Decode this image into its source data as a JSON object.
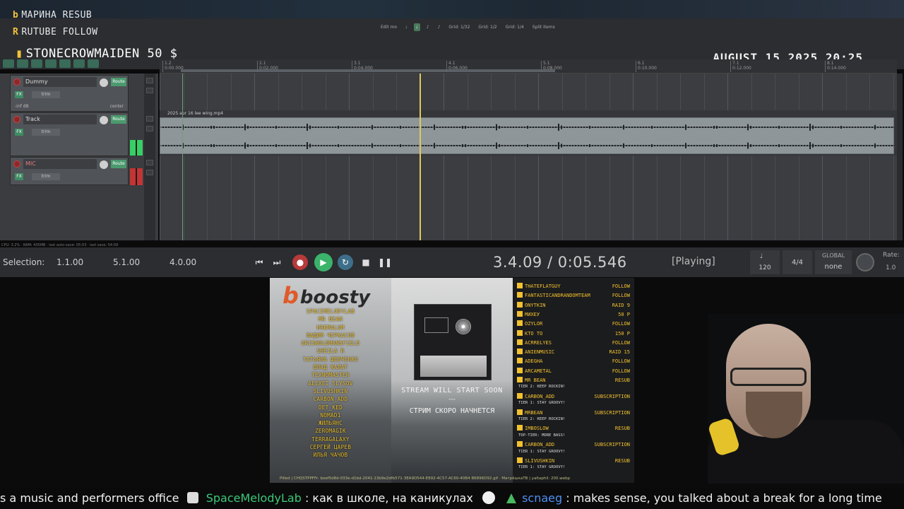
{
  "alerts": {
    "line1": "МАРИНА RESUB",
    "line2": "RUTUBE FOLLOW",
    "line3": "STONECROWMAIDEN 50 $"
  },
  "datetime": "AUGUST 15 2025 20:25",
  "toolbar_mid": {
    "edit_label": "Edit mo",
    "grid1": "Grid: 1/32",
    "grid2": "Grid: 1/2",
    "grid3": "Grid: 1/4",
    "split": "Split items"
  },
  "ruler": {
    "ticks": [
      "1.2",
      "2.1",
      "3.1",
      "4.1",
      "5.1",
      "6.1",
      "7.1",
      "8.1"
    ],
    "times": [
      "0:00.000",
      "0:02.000",
      "0:04.000",
      "0:06.000",
      "0:08.000",
      "0:10.000",
      "0:12.000",
      "0:14.000"
    ]
  },
  "tracks": [
    {
      "name": "Dummy",
      "sub": "-inf dB",
      "pan": "center",
      "route": "Route",
      "trim": "trim"
    },
    {
      "name": "Track",
      "route": "Route",
      "trim": "trim"
    },
    {
      "name": "MIC",
      "route": "Route",
      "trim": "trim"
    }
  ],
  "item_label": "2025 apr 16 lee wing.mp4",
  "tcp_footer": "CPU: 3.2% · RAM: 435MB · last auto-save: 05:03 · last save: 54:09",
  "transport": {
    "selection_label": "Selection:",
    "sel_start": "1.1.00",
    "sel_end": "5.1.00",
    "sel_len": "4.0.00",
    "position": "3.4.09 / 0:05.546",
    "status": "[Playing]",
    "bpm": "120",
    "time_sig": "4/4",
    "global_label": "GLOBAL",
    "global_value": "none",
    "rate_label": "Rate:",
    "rate_value": "1.0"
  },
  "boosty": {
    "brand": "boosty",
    "supporters": [
      "SPACEMELODYLAB",
      "MR BEAN",
      "HREMALUM",
      "ВАДИМ ЧЕРКАСОВ",
      "GRISWOLDMANSFIELD",
      "SHEILA R",
      "ТАТЬЯНА ШЕВЧЕНКО",
      "ВЛАД КАЛАТ",
      "TEXNOMASTER",
      "ALEXEI SLYSOV",
      "SLIVUSHKIN",
      "CARBON_ADD",
      "DET_KED",
      "NOMAD1",
      "ЖИЛЬЯНС",
      "ZEROMAGIK",
      "TERRAGALAXY",
      "СЕРГЕЙ ЦАРЕВ",
      "ИЛЬЯ ЧАЧОВ"
    ]
  },
  "cover": {
    "msg1": "STREAM WILL START SOON",
    "dash": "---",
    "msg2": "СТРИМ СКОРО НАЧНЕТСЯ"
  },
  "events": [
    {
      "user": "THATEFLATGUY",
      "action": "FOLLOW"
    },
    {
      "user": "FANTASTICANDRANDOMTEAM",
      "action": "FOLLOW"
    },
    {
      "user": "ONYTKIN",
      "action": "RAID 9"
    },
    {
      "user": "МИХЕУ",
      "action": "50 Р"
    },
    {
      "user": "OZYLOR",
      "action": "FOLLOW"
    },
    {
      "user": "КТО ТО",
      "action": "150 Р"
    },
    {
      "user": "ACRRELYES",
      "action": "FOLLOW"
    },
    {
      "user": "ANIENMUSIC",
      "action": "RAID 15"
    },
    {
      "user": "ADEGHA",
      "action": "FOLLOW"
    },
    {
      "user": "ARCAMETAL",
      "action": "FOLLOW"
    },
    {
      "user": "MR BEAN",
      "action": "RESUB",
      "sub": "TIER 2: KEEP ROCKIN!"
    },
    {
      "user": "CARBON_ADD",
      "action": "SUBSCRIPTION",
      "sub": "TIER 1: STAY GROOVY!"
    },
    {
      "user": "MRBEAN",
      "action": "SUBSCRIPTION",
      "sub": "TIER 2: KEEP ROCKIN!"
    },
    {
      "user": "IMBOSLOW",
      "action": "RESUB",
      "sub": "TOP-TIER: MORE BASS!"
    },
    {
      "user": "CARBON_ADD",
      "action": "SUBSCRIPTION",
      "sub": "TIER 1: STAY GROOVY!"
    },
    {
      "user": "SLIVUSHKIN",
      "action": "RESUB",
      "sub": "TIER 1: STAY GROOVY!"
    }
  ],
  "scene_footer": "Pilled | CHQSTPPFFr: boef5d8d-033e-d1bd-2041-13b9e2dfb571-3EA9D544-E892-4C57-AC60-40B4 B6896D92.gif · МатрёшкаTB | yaltaphil: 200.webp",
  "chat": {
    "msg0": "s a music and performers office",
    "user1": "SpaceMelodyLab",
    "msg1": ": как в школе, на каникулах",
    "user2": "scnaeg",
    "msg2": ": makes sense, you talked about a break for a long time"
  },
  "colors": {
    "accent_gold": "#f2c12e",
    "daw_bg": "#3b3d41",
    "play_green": "#3bb36a",
    "record_red": "#b83a3a",
    "chat_green": "#3cc879",
    "chat_blue": "#4f8ff3"
  }
}
